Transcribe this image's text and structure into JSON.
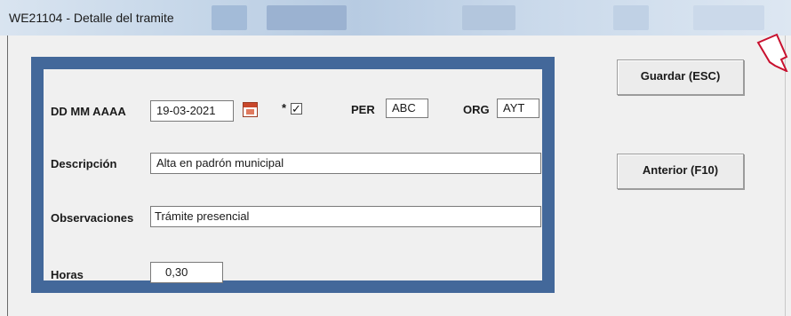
{
  "window": {
    "title": "WE21104 - Detalle del tramite"
  },
  "form": {
    "date_label": "DD MM AAAA",
    "date_value": "19-03-2021",
    "asterisk": "*",
    "check_mark": "✓",
    "per_label": "PER",
    "per_value": "ABC",
    "org_label": "ORG",
    "org_value": "AYT",
    "descripcion_label": "Descripción",
    "descripcion_value": "Alta en padrón municipal",
    "observaciones_label": "Observaciones",
    "observaciones_value": "Trámite presencial",
    "horas_label": "Horas",
    "horas_value": "0,30"
  },
  "buttons": {
    "guardar_label": "Guardar (ESC)",
    "anterior_label": "Anterior (F10)"
  },
  "colors": {
    "frame": "#43689a",
    "arrow": "#c8102e"
  },
  "icons": {
    "calendar": "calendar-icon",
    "arrow": "pointer-arrow-icon"
  }
}
